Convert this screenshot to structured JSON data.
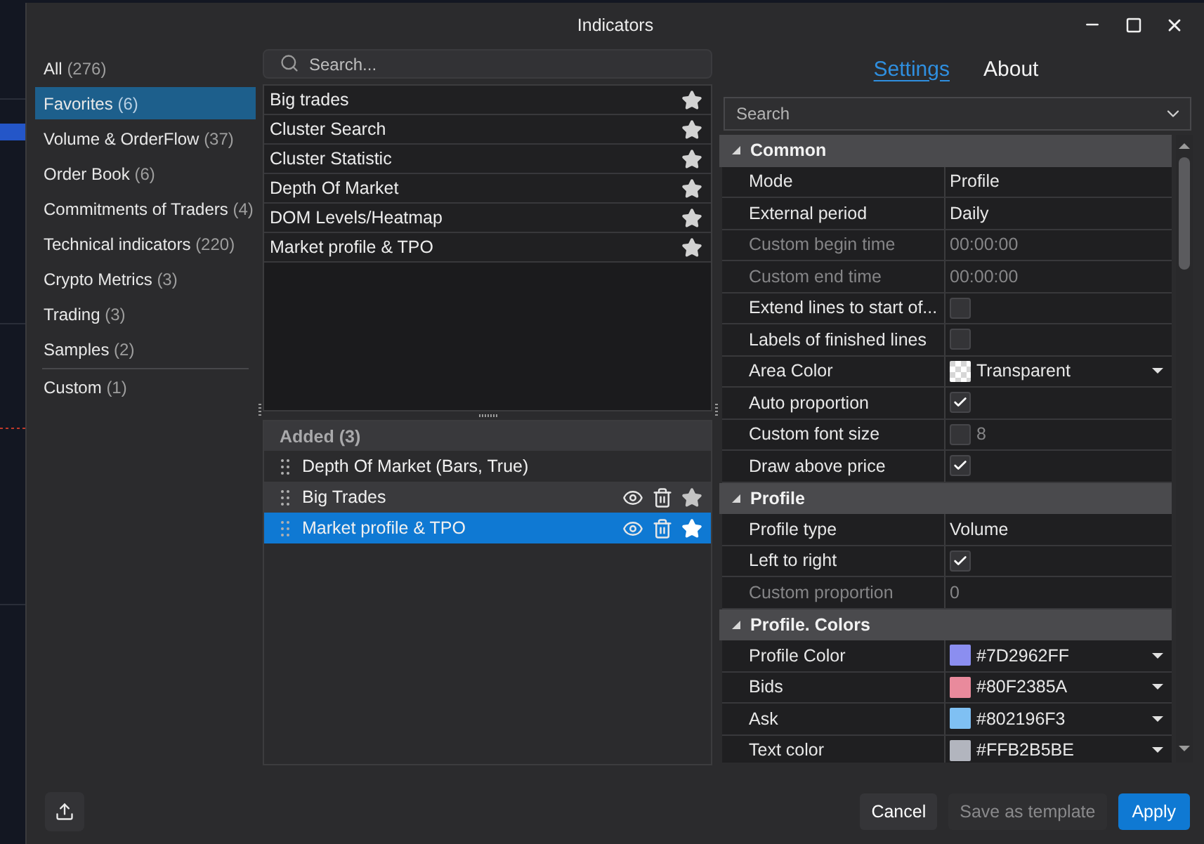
{
  "window": {
    "title": "Indicators"
  },
  "categories": [
    {
      "label": "All",
      "count": "(276)",
      "selected": false
    },
    {
      "label": "Favorites",
      "count": "(6)",
      "selected": true
    },
    {
      "label": "Volume & OrderFlow",
      "count": "(37)",
      "selected": false
    },
    {
      "label": "Order Book",
      "count": "(6)",
      "selected": false
    },
    {
      "label": "Commitments of Traders",
      "count": "(4)",
      "selected": false
    },
    {
      "label": "Technical indicators",
      "count": "(220)",
      "selected": false
    },
    {
      "label": "Crypto Metrics",
      "count": "(3)",
      "selected": false
    },
    {
      "label": "Trading",
      "count": "(3)",
      "selected": false
    },
    {
      "label": "Samples",
      "count": "(2)",
      "selected": false
    }
  ],
  "custom_categories": [
    {
      "label": "Custom",
      "count": "(1)",
      "selected": false
    }
  ],
  "search": {
    "placeholder": "Search..."
  },
  "indicators": [
    {
      "name": "Big trades",
      "favorite": true
    },
    {
      "name": "Cluster Search",
      "favorite": true
    },
    {
      "name": "Cluster Statistic",
      "favorite": true
    },
    {
      "name": "Depth Of Market",
      "favorite": true
    },
    {
      "name": "DOM Levels/Heatmap",
      "favorite": true
    },
    {
      "name": "Market profile & TPO",
      "favorite": true
    }
  ],
  "added": {
    "title": "Added (3)",
    "items": [
      {
        "name": "Depth Of Market (Bars, True)",
        "selected": false,
        "hovered": false
      },
      {
        "name": "Big Trades",
        "selected": false,
        "hovered": true
      },
      {
        "name": "Market profile & TPO",
        "selected": true,
        "hovered": false
      }
    ]
  },
  "settings_tabs": [
    {
      "label": "Settings",
      "selected": true
    },
    {
      "label": "About",
      "selected": false
    }
  ],
  "property_search": {
    "placeholder": "Search"
  },
  "property_groups": [
    {
      "title": "Common",
      "expanded": true,
      "rows": [
        {
          "name": "Mode",
          "kind": "text",
          "value": "Profile",
          "disabled": false
        },
        {
          "name": "External period",
          "kind": "text",
          "value": "Daily",
          "disabled": false
        },
        {
          "name": "Custom begin time",
          "kind": "text",
          "value": "00:00:00",
          "disabled": true
        },
        {
          "name": "Custom end time",
          "kind": "text",
          "value": "00:00:00",
          "disabled": true
        },
        {
          "name": "Extend lines to start of...",
          "kind": "checkbox",
          "checked": false,
          "disabled": false
        },
        {
          "name": "Labels of finished lines",
          "kind": "checkbox",
          "checked": false,
          "disabled": false
        },
        {
          "name": "Area Color",
          "kind": "color",
          "value": "Transparent",
          "disabled": false
        },
        {
          "name": "Auto proportion",
          "kind": "checkbox",
          "checked": true,
          "disabled": false
        },
        {
          "name": "Custom font size",
          "kind": "checkbox_number",
          "checked": false,
          "value": "8",
          "disabled": false
        },
        {
          "name": "Draw above price",
          "kind": "checkbox",
          "checked": true,
          "disabled": false
        }
      ]
    },
    {
      "title": "Profile",
      "expanded": true,
      "rows": [
        {
          "name": "Profile type",
          "kind": "text",
          "value": "Volume",
          "disabled": false
        },
        {
          "name": "Left to right",
          "kind": "checkbox",
          "checked": true,
          "disabled": false
        },
        {
          "name": "Custom proportion",
          "kind": "text",
          "value": "0",
          "disabled": true
        }
      ]
    },
    {
      "title": "Profile. Colors",
      "expanded": true,
      "rows": [
        {
          "name": "Profile Color",
          "kind": "color",
          "value": "#7D2962FF",
          "color": "#8b8ef0",
          "disabled": false
        },
        {
          "name": "Bids",
          "kind": "color",
          "value": "#80F2385A",
          "color": "#e98a9c",
          "disabled": false
        },
        {
          "name": "Ask",
          "kind": "color",
          "value": "#802196F3",
          "color": "#7fc0f3",
          "disabled": false
        },
        {
          "name": "Text color",
          "kind": "color",
          "value": "#FFB2B5BE",
          "color": "#b2b5be",
          "disabled": false
        }
      ]
    }
  ],
  "footer": {
    "buttons": [
      {
        "label": "Cancel",
        "kind": "secondary",
        "disabled": false
      },
      {
        "label": "Save as template",
        "kind": "secondary",
        "disabled": true
      },
      {
        "label": "Apply",
        "kind": "primary",
        "disabled": false
      }
    ]
  }
}
